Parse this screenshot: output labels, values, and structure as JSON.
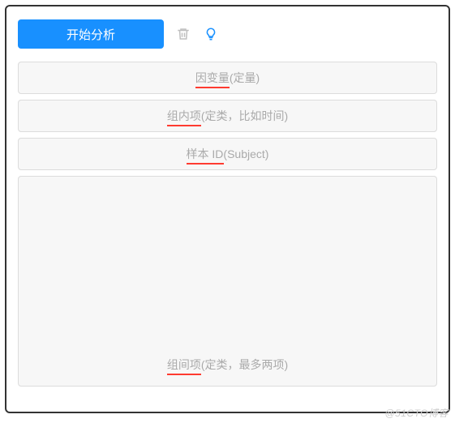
{
  "toolbar": {
    "start_label": "开始分析"
  },
  "dropzones": {
    "dependent": "因变量(定量)",
    "within": "组内项(定类，比如时间)",
    "subject": "样本 ID(Subject)",
    "between": "组间项(定类，最多两项)"
  },
  "watermark": "@51CTO博客"
}
